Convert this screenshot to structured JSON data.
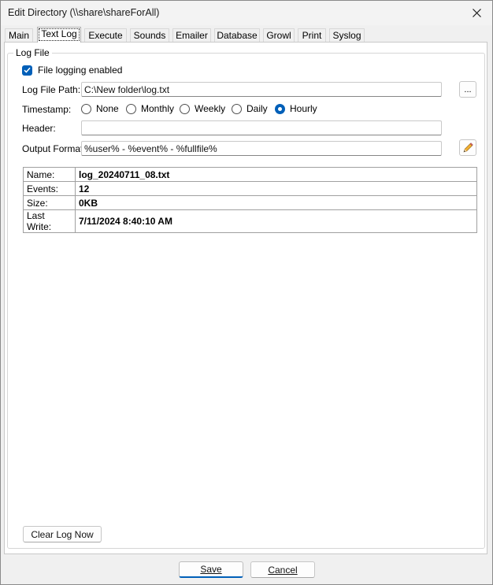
{
  "window": {
    "title": "Edit Directory (\\\\share\\shareForAll)"
  },
  "tabs": [
    {
      "label": "Main",
      "active": false
    },
    {
      "label": "Text Log",
      "active": true
    },
    {
      "label": "Execute",
      "active": false
    },
    {
      "label": "Sounds",
      "active": false
    },
    {
      "label": "Emailer",
      "active": false
    },
    {
      "label": "Database",
      "active": false
    },
    {
      "label": "Growl",
      "active": false
    },
    {
      "label": "Print",
      "active": false
    },
    {
      "label": "Syslog",
      "active": false
    }
  ],
  "log_file": {
    "group_label": "Log File",
    "logging_enabled_label": "File logging enabled",
    "logging_enabled": true,
    "path_label": "Log File Path:",
    "path_value": "C:\\New folder\\log.txt",
    "browse_label": "...",
    "timestamp_label": "Timestamp:",
    "timestamp_options": [
      {
        "label": "None",
        "selected": false
      },
      {
        "label": "Monthly",
        "selected": false
      },
      {
        "label": "Weekly",
        "selected": false
      },
      {
        "label": "Daily",
        "selected": false
      },
      {
        "label": "Hourly",
        "selected": true
      }
    ],
    "header_label": "Header:",
    "header_value": "",
    "output_format_label": "Output Format:",
    "output_format_value": "%user% - %event% - %fullfile%",
    "edit_format_icon": "pencil-icon"
  },
  "file_info": [
    {
      "key": "Name:",
      "value": "log_20240711_08.txt"
    },
    {
      "key": "Events:",
      "value": "12"
    },
    {
      "key": "Size:",
      "value": "0KB"
    },
    {
      "key": "Last Write:",
      "value": "7/11/2024 8:40:10 AM"
    }
  ],
  "actions": {
    "clear_log": "Clear Log Now",
    "save": "Save",
    "cancel": "Cancel"
  },
  "colors": {
    "accent": "#005fb8"
  }
}
